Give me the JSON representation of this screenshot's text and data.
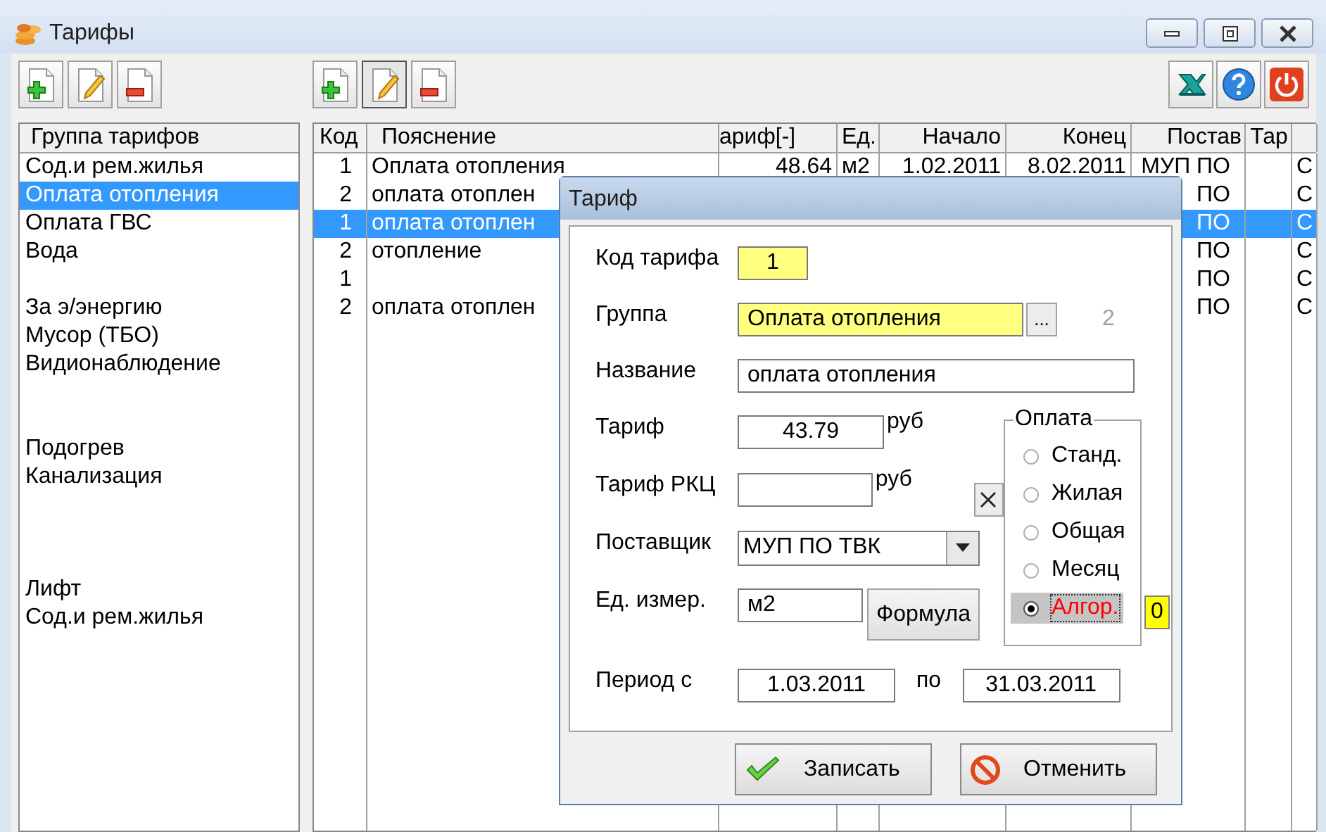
{
  "window": {
    "title": "Тарифы"
  },
  "groups": {
    "header": "Группа тарифов",
    "items": [
      {
        "kind": "item",
        "label": "Сод.и рем.жилья",
        "selected": false
      },
      {
        "kind": "item",
        "label": "Оплата отопления",
        "selected": true
      },
      {
        "kind": "item",
        "label": "Оплата ГВС",
        "selected": false
      },
      {
        "kind": "item",
        "label": "Вода",
        "selected": false
      },
      {
        "kind": "empty"
      },
      {
        "kind": "item",
        "label": "За э/энергию",
        "selected": false
      },
      {
        "kind": "item",
        "label": "Мусор (ТБО)",
        "selected": false
      },
      {
        "kind": "item",
        "label": "Видионаблюдение",
        "selected": false
      },
      {
        "kind": "empty"
      },
      {
        "kind": "empty"
      },
      {
        "kind": "item",
        "label": "Подогрев",
        "selected": false
      },
      {
        "kind": "item",
        "label": "Канализация",
        "selected": false
      },
      {
        "kind": "empty"
      },
      {
        "kind": "empty"
      },
      {
        "kind": "empty"
      },
      {
        "kind": "item",
        "label": "Лифт",
        "selected": false
      },
      {
        "kind": "item",
        "label": "Сод.и рем.жилья",
        "selected": false
      }
    ]
  },
  "tariffs": {
    "columns": [
      "Код",
      "Пояснение",
      "ариф[-]",
      "Ед.",
      "Начало",
      "Конец",
      "Постав",
      "Тар",
      null
    ],
    "rows": [
      {
        "selected": false,
        "cells": [
          "1",
          "Оплата отопления",
          "48.64",
          "м2",
          "1.02.2011",
          "8.02.2011",
          "МУП ПО",
          null,
          "С"
        ]
      },
      {
        "selected": false,
        "cells": [
          "2",
          "оплата отоплен",
          null,
          null,
          null,
          null,
          "ПО",
          null,
          "С"
        ]
      },
      {
        "selected": true,
        "cells": [
          "1",
          "оплата отоплен",
          null,
          null,
          null,
          null,
          "ПО",
          null,
          "С"
        ]
      },
      {
        "selected": false,
        "cells": [
          "2",
          "отопление",
          null,
          null,
          null,
          null,
          "ПО",
          null,
          "С"
        ]
      },
      {
        "selected": false,
        "cells": [
          "1",
          null,
          null,
          null,
          null,
          null,
          "ПО",
          null,
          "С"
        ]
      },
      {
        "selected": false,
        "cells": [
          "2",
          "оплата отоплен",
          null,
          null,
          null,
          null,
          "ПО",
          null,
          "С"
        ]
      }
    ]
  },
  "dialog": {
    "title": "Тариф",
    "code": {
      "label": "Код тарифа",
      "value": "1"
    },
    "group": {
      "label": "Группа",
      "value": "Оплата отопления",
      "browse": "...",
      "number": "2"
    },
    "name": {
      "label": "Название",
      "value": "оплата отопления"
    },
    "tariff": {
      "label": "Тариф",
      "value": "43.79",
      "unit": "руб"
    },
    "tariff_rkc": {
      "label": "Тариф РКЦ",
      "unit": "руб"
    },
    "supplier": {
      "label": "Поставщик",
      "value": "МУП ПО ТВК"
    },
    "unit": {
      "label": "Ед. измер.",
      "value": "м2",
      "button": "Формула"
    },
    "payment": {
      "title": "Оплата",
      "options": [
        {
          "label": "Станд.",
          "selected": false
        },
        {
          "label": "Жилая",
          "selected": false
        },
        {
          "label": "Общая",
          "selected": false
        },
        {
          "label": "Месяц",
          "selected": false
        },
        {
          "label": "Алгор.",
          "selected": true
        }
      ],
      "badge": "0"
    },
    "period": {
      "label": "Период с",
      "from": "1.03.2011",
      "to_label": "по",
      "to": "31.03.2011"
    },
    "buttons": [
      {
        "kind": "ok",
        "label": "Записать"
      },
      {
        "kind": "cancel",
        "label": "Отменить"
      }
    ]
  }
}
